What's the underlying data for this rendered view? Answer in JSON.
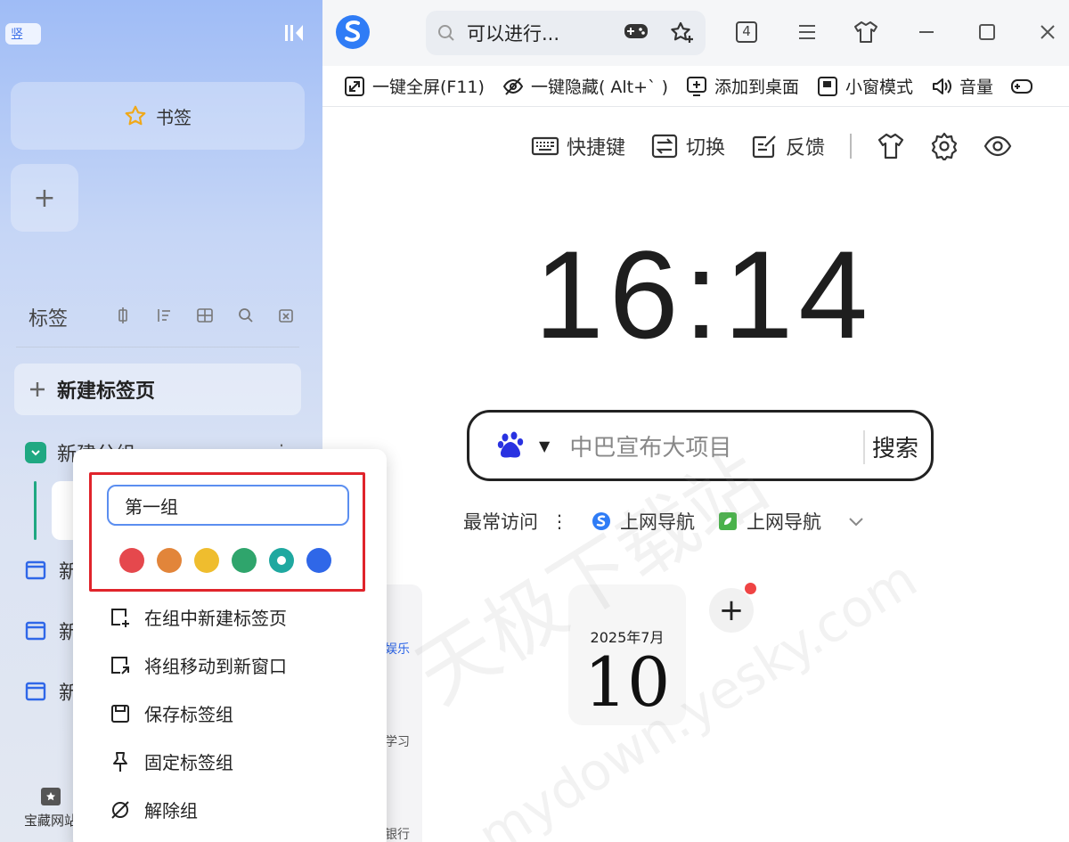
{
  "sidebar": {
    "mode_badge": "竖",
    "bookmark_label": "书签",
    "add_symbol": "+",
    "tabs_title": "标签",
    "new_tab_label": "新建标签页",
    "group_name": "新建分组",
    "tab_items": [
      "新",
      "新",
      "新"
    ],
    "bottom_nav_label": "宝藏网站"
  },
  "topbar": {
    "search_text": "可以进行...",
    "tab_count": "4",
    "toolbar": [
      {
        "label": "一键全屏(F11)",
        "icon": "fullscreen-icon"
      },
      {
        "label": "一键隐藏( Alt+` )",
        "icon": "hide-icon"
      },
      {
        "label": "添加到桌面",
        "icon": "add-desktop-icon"
      },
      {
        "label": "小窗模式",
        "icon": "mini-window-icon"
      },
      {
        "label": "音量",
        "icon": "volume-icon"
      }
    ]
  },
  "newtab": {
    "quick": {
      "shortcut": "快捷键",
      "switch": "切换",
      "feedback": "反馈"
    },
    "clock": "16:14",
    "search_placeholder": "中巴宣布大项目",
    "search_button": "搜索",
    "frequent_label": "最常访问",
    "frequent_items": [
      "上网导航",
      "上网导航"
    ],
    "calendar_month": "2025年7月",
    "calendar_day": "10",
    "add_symbol": "+",
    "behind_labels": [
      "娱乐",
      "学习",
      "银行"
    ]
  },
  "watermark": {
    "cn": "天极下载站",
    "en": "mydown.yesky.com"
  },
  "context_menu": {
    "group_name_value": "第一组",
    "colors": [
      "#e5484d",
      "#e2853a",
      "#efbd2e",
      "#2fa56c",
      "#1fa8a0",
      "#2f67e8"
    ],
    "selected_color_index": 4,
    "items": [
      "在组中新建标签页",
      "将组移动到新窗口",
      "保存标签组",
      "固定标签组",
      "解除组"
    ]
  },
  "colors": {
    "accent": "#3a6ee8",
    "group_teal": "#1fa882",
    "highlight_red": "#e0242b"
  }
}
